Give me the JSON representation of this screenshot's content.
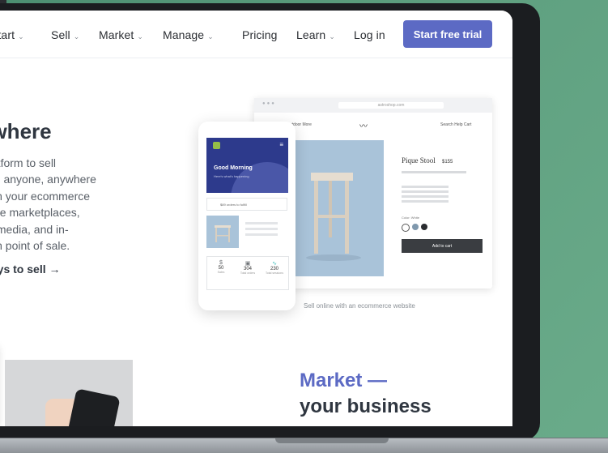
{
  "nav": {
    "items": [
      {
        "label": "Start",
        "chevron": "⌄"
      },
      {
        "label": "Sell",
        "chevron": "⌄"
      },
      {
        "label": "Market",
        "chevron": "⌄"
      },
      {
        "label": "Manage",
        "chevron": "⌄"
      },
      {
        "label": "Pricing"
      },
      {
        "label": "Learn",
        "chevron": "⌄"
      },
      {
        "label": "Log in"
      }
    ],
    "cta": "Start free trial"
  },
  "hero": {
    "title": "ywhere",
    "lines": [
      "platform to sell",
      "s to anyone, anywhere",
      "with your ecommerce",
      "nline marketplaces,",
      "ial media, and in-",
      "with point of sale."
    ],
    "link": "ways to sell →"
  },
  "desktop_mock": {
    "url": "astroshop.com",
    "nav": "Outdoor  More",
    "right_nav": "Search  Help  Cart",
    "product_title": "Pique Stool",
    "price": "$155",
    "swatch_label": "Color: White",
    "add_to_cart": "Add to cart",
    "caption": "Sell online with an ecommerce website"
  },
  "phone_mock": {
    "greeting": "Good Morning",
    "subtitle": "Here's what's happening",
    "card_text": "$89 orders to fulfill",
    "stats": [
      {
        "value": "50",
        "label": "Sales"
      },
      {
        "value": "304",
        "label": "Total orders"
      },
      {
        "value": "230",
        "label": "Total sessions"
      }
    ]
  },
  "section2": {
    "title_accent": "Market —",
    "title_main": "your business"
  },
  "colors": {
    "brand": "#5c6ac4",
    "bg_green": "#5fa080",
    "shopify_green": "#95bf47"
  }
}
